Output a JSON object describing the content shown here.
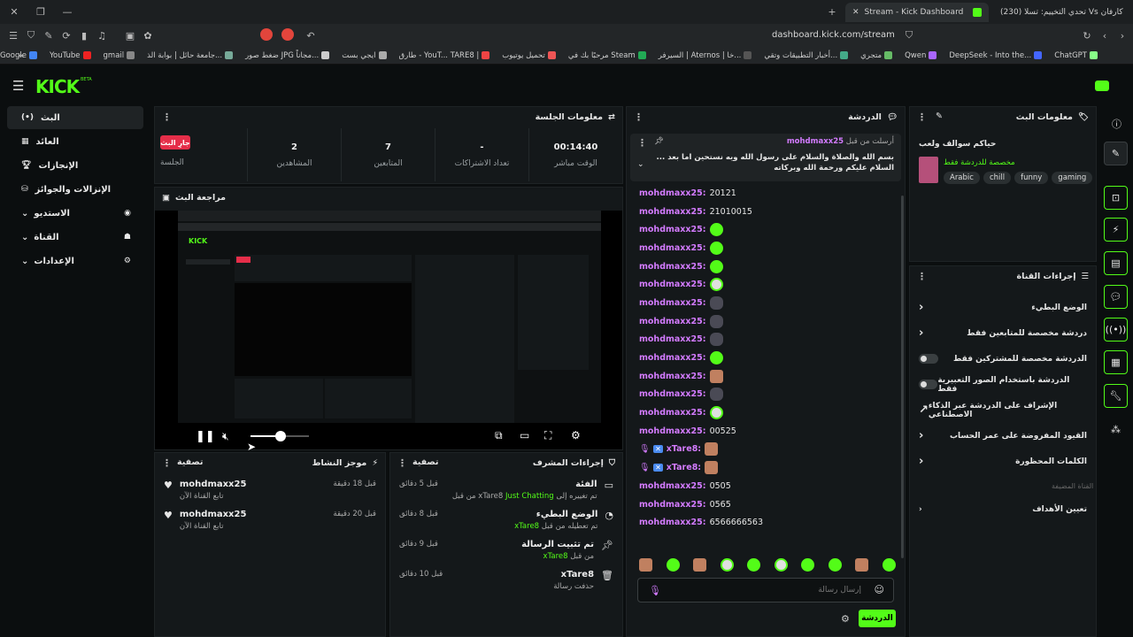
{
  "browser": {
    "tabs": [
      {
        "title": "Stream - Kick Dashboard"
      },
      {
        "title": "(230) تحدي التخييم: تسلا Vs كارفان"
      }
    ],
    "url": "dashboard.kick.com/stream",
    "bookmarks": [
      "Google",
      "YouTube",
      "gmail",
      "جامعة حائل | بوابة الذ...",
      "ضغط صور JPG مجاناً...",
      "ايجي بست",
      "طارق - YouT... TARE8 |",
      "تحميل يوتيوب",
      "مرحبًا بك في Steam",
      "السيرفر | Aternos | خا...",
      "أخبار التطبيقات وتقي...",
      "متجري",
      "Qwen",
      "DeepSeek - Into the...",
      "ChatGPT"
    ]
  },
  "app": {
    "logo": "KICK",
    "logo_badge": "BETA",
    "sidebar": [
      {
        "label": "البث",
        "icon": "broadcast-icon",
        "active": true
      },
      {
        "label": "العائد",
        "icon": "chart-icon"
      },
      {
        "label": "الإنجازات",
        "icon": "trophy-icon"
      },
      {
        "label": "الإنزالات والجوائز",
        "icon": "gift-icon"
      },
      {
        "label": "الاستديو",
        "icon": "studio-icon",
        "chev": true
      },
      {
        "label": "القناة",
        "icon": "channel-icon",
        "chev": true
      },
      {
        "label": "الإعدادات",
        "icon": "settings-icon",
        "chev": true
      }
    ],
    "session": {
      "title": "معلومات الجلسة",
      "live_badge": "جارِ البث",
      "session_label": "الجلسة",
      "stats": [
        {
          "value": "00:14:40",
          "label": "الوقت مباشر"
        },
        {
          "value": "-",
          "label": "تعداد الاشتراكات"
        },
        {
          "value": "7",
          "label": "المتابعين"
        },
        {
          "value": "2",
          "label": "المشاهدين"
        }
      ]
    },
    "preview": {
      "title": "مراجعة البث",
      "progress": 0.52
    },
    "activity": {
      "title": "موجز النشاط",
      "filter": "تصفية",
      "items": [
        {
          "user": "mohdmaxx25",
          "sub": "تابع القناة الآن",
          "time": "قبل 18 دقيقة"
        },
        {
          "user": "mohdmaxx25",
          "sub": "تابع القناة الآن",
          "time": "قبل 20 دقيقة"
        }
      ]
    },
    "mod_actions": {
      "title": "إجراءات المشرف",
      "filter": "تصفية",
      "items": [
        {
          "title": "الفئة",
          "sub_pre": "تم تغييره إلى",
          "sub_grn": "Just Chatting",
          "sub_post": "من قبل xTare8",
          "time": "قبل 5 دقائق"
        },
        {
          "title": "الوضع البطيء",
          "sub_pre": "تم تعطيله من قبل",
          "sub_grn": "xTare8",
          "sub_post": "",
          "time": "قبل 8 دقائق"
        },
        {
          "title": "تم تثبيت الرسالة",
          "sub_pre": "من قبل",
          "sub_grn": "xTare8",
          "sub_post": "",
          "time": "قبل 9 دقائق"
        },
        {
          "title": "xTare8",
          "sub_pre": "حذفت رسالة",
          "sub_grn": "",
          "sub_post": "",
          "time": "قبل 10 دقائق"
        }
      ]
    },
    "chat": {
      "title": "الدردشة",
      "pinned_user": "mohdmaxx25",
      "pinned_by": "أرسلت من قبل",
      "pinned_text": "بسم الله والصلاة والسلام على رسول الله ويه نستحين اما بعد ... السلام عليكم ورحمة الله وبركاته",
      "messages": [
        {
          "user": "mohdmaxx25:",
          "text": "20121"
        },
        {
          "user": "mohdmaxx25:",
          "text": "21010015"
        },
        {
          "user": "mohdmaxx25:",
          "emote": "g"
        },
        {
          "user": "mohdmaxx25:",
          "emote": "g"
        },
        {
          "user": "mohdmaxx25:",
          "emote": "g"
        },
        {
          "user": "mohdmaxx25:",
          "emote": "w"
        },
        {
          "user": "mohdmaxx25:",
          "emote": "x"
        },
        {
          "user": "mohdmaxx25:",
          "emote": "x"
        },
        {
          "user": "mohdmaxx25:",
          "emote": "x"
        },
        {
          "user": "mohdmaxx25:",
          "emote": "g"
        },
        {
          "user": "mohdmaxx25:",
          "emote": "s"
        },
        {
          "user": "mohdmaxx25:",
          "emote": "x"
        },
        {
          "user": "mohdmaxx25:",
          "emote": "w"
        },
        {
          "user": "mohdmaxx25:",
          "text": "00525"
        },
        {
          "user": "xTare8:",
          "emote": "s",
          "mod": true
        },
        {
          "user": "xTare8:",
          "emote": "s",
          "mod": true
        },
        {
          "user": "mohdmaxx25:",
          "text": "0505"
        },
        {
          "user": "mohdmaxx25:",
          "text": "0565"
        },
        {
          "user": "mohdmaxx25:",
          "text": "6566666563"
        }
      ],
      "input_placeholder": "إرسال رسالة",
      "send_label": "الدردشة"
    },
    "stream_info": {
      "title": "معلومات البث",
      "stream_title": "حياكم سوالف ولعب",
      "restriction": "مخصصة للدردشة فقط",
      "tags": [
        "gaming",
        "funny",
        "chill",
        "Arabic"
      ]
    },
    "channel_actions": {
      "title": "إجراءات القناة",
      "rows": [
        {
          "label": "الوضع البطيء",
          "kind": "chev"
        },
        {
          "label": "دردشة مخصصة للمتابعين فقط",
          "kind": "chev"
        },
        {
          "label": "الدردشة مخصصة للمشتركين فقط",
          "kind": "toggle"
        },
        {
          "label": "الدردشة باستخدام الصور التعبيرية فقط",
          "kind": "toggle"
        },
        {
          "label": "الإشراف على الدردشة عبر الذكاء الاصطناعي",
          "kind": "ext"
        },
        {
          "label": "القيود المفروضة على عمر الحساب",
          "kind": "chev"
        },
        {
          "label": "الكلمات المحظورة",
          "kind": "chev"
        }
      ],
      "section": "القناة المضيفة",
      "target": "تعيين الأهداف"
    }
  }
}
